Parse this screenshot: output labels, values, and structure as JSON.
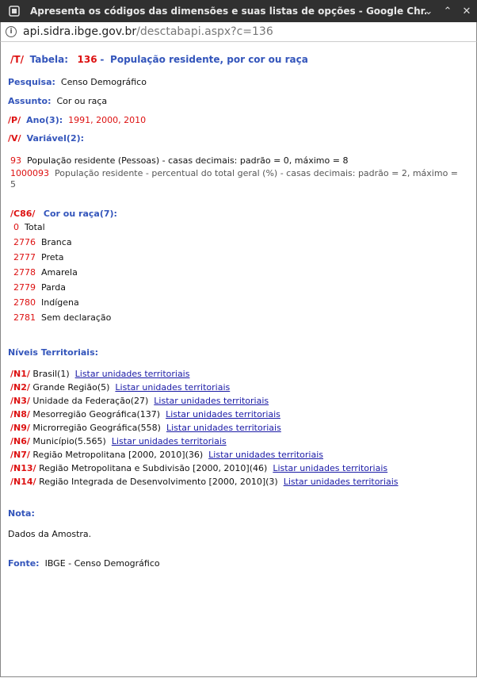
{
  "window": {
    "title": "Apresenta os códigos das dimensões e suas listas de opções - Google Chr...",
    "minimize_glyph": "⌄",
    "maximize_glyph": "⌃",
    "close_glyph": "✕"
  },
  "address": {
    "domain": "api.sidra.ibge.gov.br",
    "path": "/desctabapi.aspx?c=136"
  },
  "table": {
    "prefix": "/T/",
    "label": "Tabela:",
    "number": "136",
    "dash": "-",
    "name": "População residente, por cor ou raça"
  },
  "pesquisa": {
    "label": "Pesquisa:",
    "value": "Censo Demográfico"
  },
  "assunto": {
    "label": "Assunto:",
    "value": "Cor ou raça"
  },
  "periodo": {
    "prefix": "/P/",
    "label": "Ano(3):",
    "value": "1991, 2000, 2010"
  },
  "variavel": {
    "prefix": "/V/",
    "label": "Variável(2):",
    "items": [
      {
        "code": "93",
        "text": "População residente (Pessoas) - casas decimais: padrão = 0, máximo = 8"
      },
      {
        "code": "1000093",
        "text": "População residente - percentual do total geral (%) - casas decimais: padrão = 2, máximo =",
        "text_cont": "5"
      }
    ]
  },
  "classificacao": {
    "prefix": "/C86/",
    "label": "Cor ou raça(7):",
    "items": [
      {
        "code": "0",
        "text": "Total"
      },
      {
        "code": "2776",
        "text": "Branca"
      },
      {
        "code": "2777",
        "text": "Preta"
      },
      {
        "code": "2778",
        "text": "Amarela"
      },
      {
        "code": "2779",
        "text": "Parda"
      },
      {
        "code": "2780",
        "text": "Indígena"
      },
      {
        "code": "2781",
        "text": "Sem declaração"
      }
    ]
  },
  "niveis": {
    "label": "Níveis Territoriais:",
    "link_label": "Listar unidades territoriais",
    "items": [
      {
        "code": "/N1/",
        "text": "Brasil(1)"
      },
      {
        "code": "/N2/",
        "text": "Grande Região(5)"
      },
      {
        "code": "/N3/",
        "text": "Unidade da Federação(27)"
      },
      {
        "code": "/N8/",
        "text": "Mesorregião Geográfica(137)"
      },
      {
        "code": "/N9/",
        "text": "Microrregião Geográfica(558)"
      },
      {
        "code": "/N6/",
        "text": "Município(5.565)"
      },
      {
        "code": "/N7/",
        "text": "Região Metropolitana [2000, 2010](36)"
      },
      {
        "code": "/N13/",
        "text": "Região Metropolitana e Subdivisão [2000, 2010](46)"
      },
      {
        "code": "/N14/",
        "text": "Região Integrada de Desenvolvimento [2000, 2010](3)"
      }
    ]
  },
  "nota": {
    "label": "Nota:",
    "value": "Dados da Amostra."
  },
  "fonte": {
    "label": "Fonte:",
    "value": "IBGE - Censo Demográfico"
  }
}
